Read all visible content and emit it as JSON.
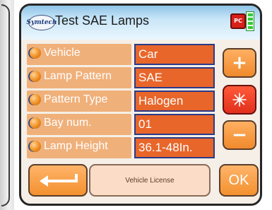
{
  "header": {
    "logo_text": "Symtech",
    "title": "Test SAE Lamps",
    "pc_label": "PC"
  },
  "fields": [
    {
      "label": "Vehicle",
      "value": "Car"
    },
    {
      "label": "Lamp Pattern",
      "value": "SAE"
    },
    {
      "label": "Pattern Type",
      "value": "Halogen"
    },
    {
      "label": "Bay num.",
      "value": "01"
    },
    {
      "label": "Lamp Height",
      "value": "36.1-48In."
    }
  ],
  "side_buttons": {
    "plus": "+",
    "minus": "−"
  },
  "bottom": {
    "license_label": "Vehicle License",
    "ok_label": "OK"
  },
  "colors": {
    "accent": "#f39a3a",
    "label_bg": "#f0b07a",
    "value_bg": "#e8662a",
    "value_border": "#2b3a88",
    "title_bar": "#8fc4e8"
  }
}
